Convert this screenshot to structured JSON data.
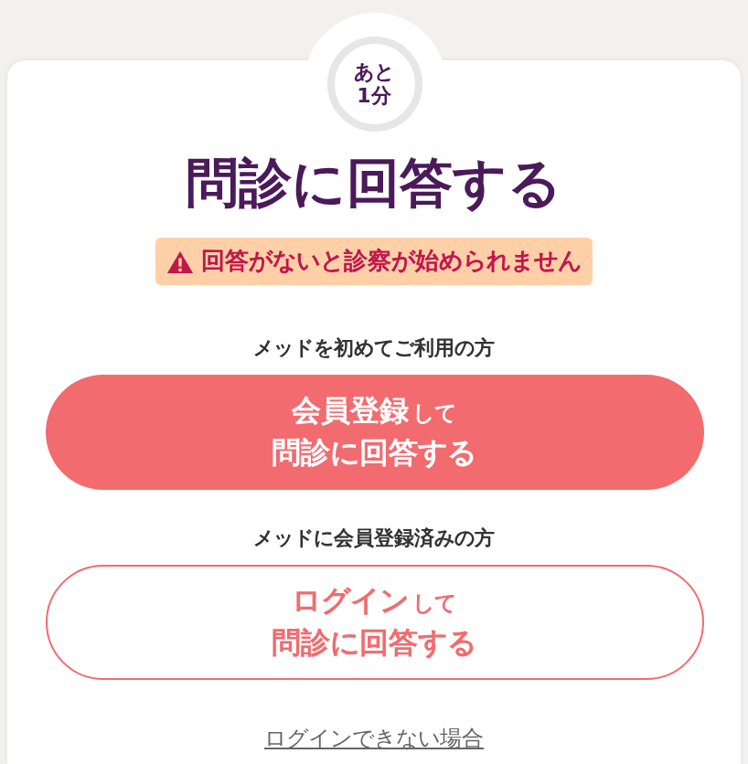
{
  "timer_badge": {
    "lines": [
      "あと",
      "1分"
    ]
  },
  "title": "問診に回答する",
  "warning": {
    "text": "回答がないと診察が始められません"
  },
  "options": [
    {
      "caption": "メッドを初めてご利用の方",
      "kind": "filled",
      "button": {
        "main": "会員登録",
        "suffix": "して",
        "line2": "問診に回答する"
      }
    },
    {
      "caption": "メッドに会員登録済みの方",
      "kind": "outline",
      "button": {
        "main": "ログイン",
        "suffix": "して",
        "line2": "問診に回答する"
      }
    }
  ],
  "help_link": "ログインできない場合"
}
